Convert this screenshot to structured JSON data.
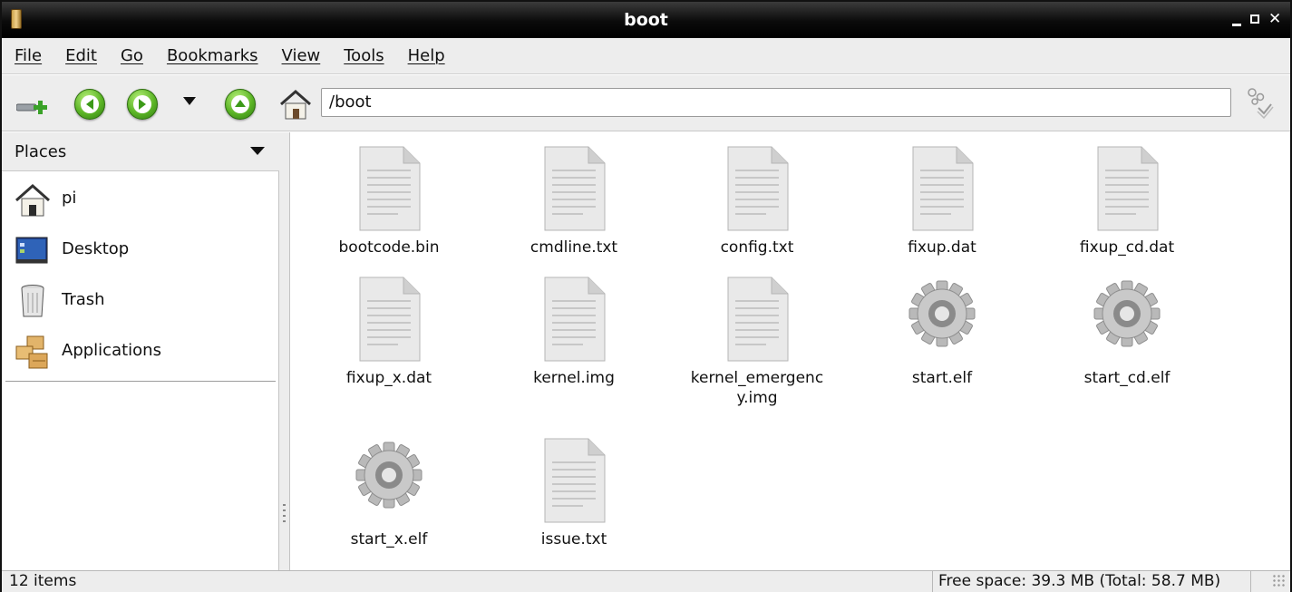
{
  "window": {
    "title": "boot"
  },
  "menubar": {
    "items": [
      {
        "label": "File"
      },
      {
        "label": "Edit"
      },
      {
        "label": "Go"
      },
      {
        "label": "Bookmarks"
      },
      {
        "label": "View"
      },
      {
        "label": "Tools"
      },
      {
        "label": "Help"
      }
    ]
  },
  "toolbar": {
    "buttons": [
      "new-tab-icon",
      "back-icon",
      "forward-icon",
      "history-dropdown-icon",
      "up-icon",
      "home-icon",
      "go-icon"
    ],
    "address": "/boot"
  },
  "sidebar": {
    "header": "Places",
    "items": [
      {
        "label": "pi",
        "icon": "home-icon"
      },
      {
        "label": "Desktop",
        "icon": "desktop-icon"
      },
      {
        "label": "Trash",
        "icon": "trash-icon"
      },
      {
        "label": "Applications",
        "icon": "applications-icon"
      }
    ]
  },
  "files": [
    {
      "name": "bootcode.bin",
      "type": "document"
    },
    {
      "name": "cmdline.txt",
      "type": "document"
    },
    {
      "name": "config.txt",
      "type": "document"
    },
    {
      "name": "fixup.dat",
      "type": "document"
    },
    {
      "name": "fixup_cd.dat",
      "type": "document"
    },
    {
      "name": "fixup_x.dat",
      "type": "document"
    },
    {
      "name": "kernel.img",
      "type": "document"
    },
    {
      "name": "kernel_emergency.img",
      "type": "document"
    },
    {
      "name": "start.elf",
      "type": "executable"
    },
    {
      "name": "start_cd.elf",
      "type": "executable"
    },
    {
      "name": "start_x.elf",
      "type": "executable"
    },
    {
      "name": "issue.txt",
      "type": "document"
    }
  ],
  "statusbar": {
    "items": "12 items",
    "free_space": "Free space: 39.3 MB (Total: 58.7 MB)"
  },
  "colors": {
    "accent_green": "#5cb526",
    "titlebar": "#0b0b0b",
    "chrome": "#ededed"
  }
}
